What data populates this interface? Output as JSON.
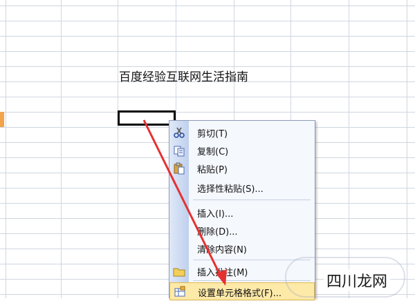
{
  "sheet": {
    "cell_text": "百度经验互联网生活指南"
  },
  "context_menu": {
    "items": [
      {
        "label": "剪切(T)",
        "icon": "scissors-icon"
      },
      {
        "label": "复制(C)",
        "icon": "copy-icon"
      },
      {
        "label": "粘贴(P)",
        "icon": "paste-icon"
      },
      {
        "label": "选择性粘贴(S)...",
        "icon": ""
      },
      {
        "label": "插入(I)...",
        "icon": ""
      },
      {
        "label": "删除(D)...",
        "icon": ""
      },
      {
        "label": "清除内容(N)",
        "icon": ""
      },
      {
        "label": "插入批注(M)",
        "icon": "folder-icon"
      },
      {
        "label": "设置单元格格式(F)...",
        "icon": "format-cells-icon"
      }
    ]
  },
  "colors": {
    "grid": "#cfd6e0",
    "arrow": "#e53030",
    "highlight": "#fde9a8"
  },
  "watermark": "四川龙网"
}
